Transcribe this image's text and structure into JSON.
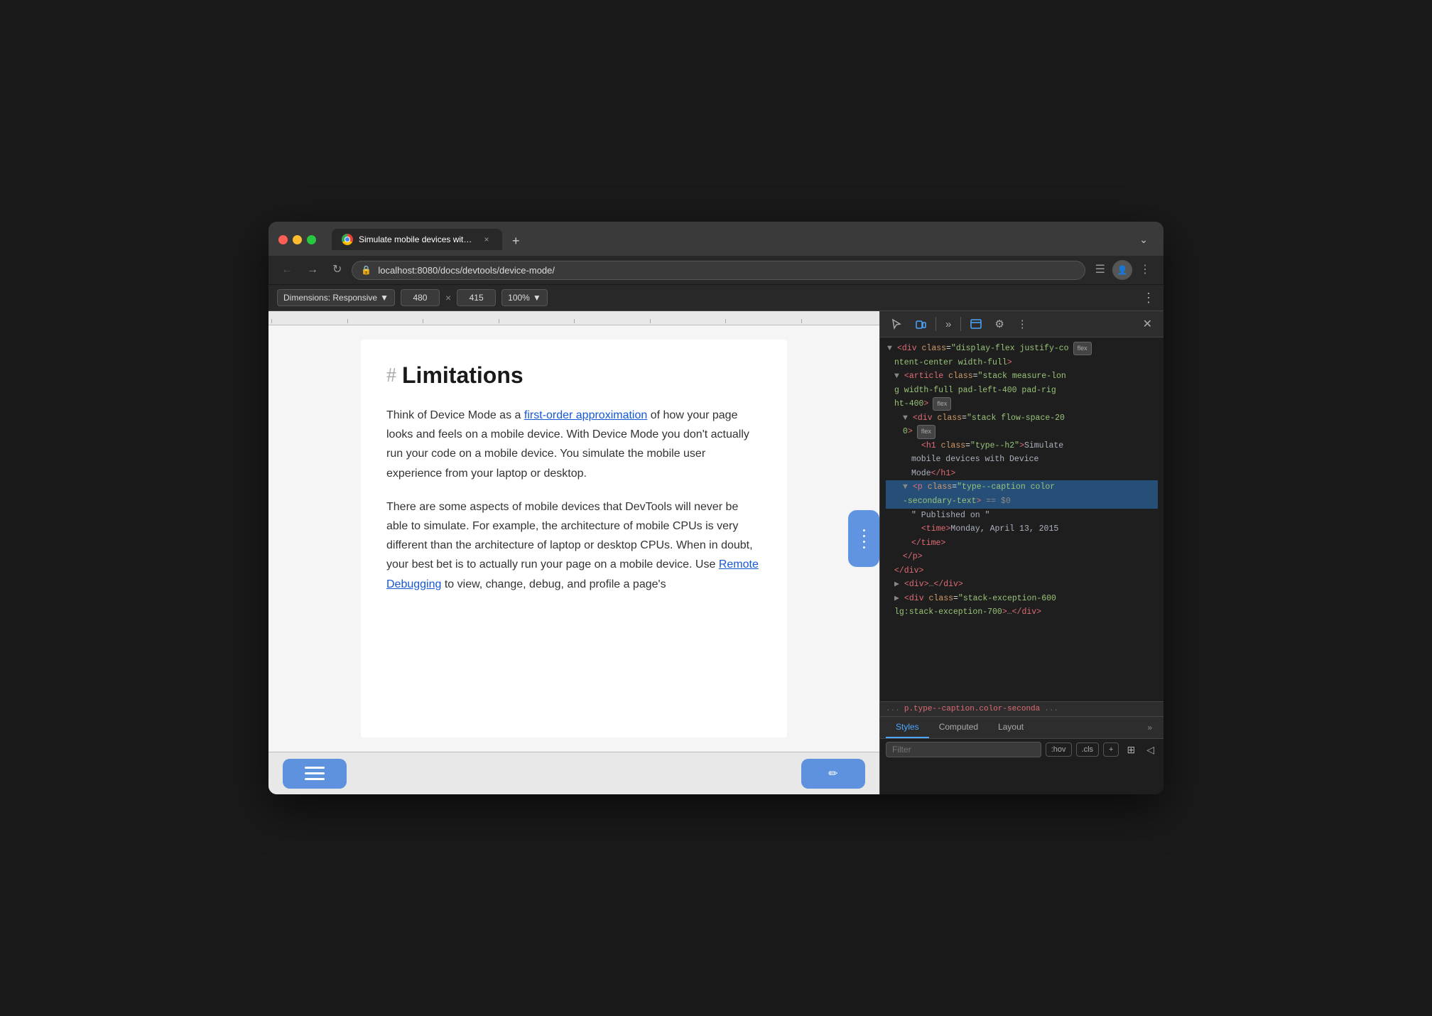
{
  "window": {
    "title": "Chrome Browser"
  },
  "titlebar": {
    "traffic_lights": [
      "close",
      "minimize",
      "maximize"
    ],
    "tab": {
      "title": "Simulate mobile devices with D",
      "close_label": "×"
    },
    "new_tab_label": "+",
    "tab_menu_label": "⌄"
  },
  "navbar": {
    "back_label": "←",
    "forward_label": "→",
    "reload_label": "↻",
    "address": "localhost:8080/docs/devtools/device-mode/",
    "toggle_sidebar_label": "☰",
    "profile_label": "Guest",
    "more_label": "⋮"
  },
  "device_toolbar": {
    "dimensions_label": "Dimensions: Responsive",
    "width_value": "480",
    "height_value": "415",
    "separator": "×",
    "zoom_label": "100%",
    "more_label": "⋮"
  },
  "viewport": {
    "heading_hash": "#",
    "heading": "Limitations",
    "paragraphs": [
      "Think of Device Mode as a first-order approximation of how your page looks and feels on a mobile device. With Device Mode you don't actually run your code on a mobile device. You simulate the mobile user experience from your laptop or desktop.",
      "There are some aspects of mobile devices that DevTools will never be able to simulate. For example, the architecture of mobile CPUs is very different than the architecture of laptop or desktop CPUs. When in doubt, your best bet is to actually run your page on a mobile device. Use Remote Debugging to view, change, debug, and profile a page's"
    ],
    "link1_text": "first-order approximation",
    "link2_text": "Remote Debugging"
  },
  "devtools": {
    "tools": [
      {
        "name": "cursor-tool",
        "icon": "↖",
        "active": false
      },
      {
        "name": "device-tool",
        "icon": "▭",
        "active": true
      },
      {
        "name": "more-panels",
        "icon": "»",
        "active": false
      },
      {
        "name": "console-tool",
        "icon": "◫",
        "active": false
      },
      {
        "name": "settings-tool",
        "icon": "⚙",
        "active": false
      },
      {
        "name": "more-tool",
        "icon": "⋮",
        "active": false
      },
      {
        "name": "close-devtools",
        "icon": "×",
        "active": false
      }
    ],
    "html_lines": [
      {
        "indent": 0,
        "content": "<div class=\"display-flex justify-co",
        "has_flex": true,
        "flex_label": "flex"
      },
      {
        "indent": 0,
        "content": "ntent-center width-full\">",
        "has_flex": false
      },
      {
        "indent": 1,
        "content": "<article class=\"stack measure-lon",
        "expanded": true
      },
      {
        "indent": 1,
        "content": "g width-full pad-left-400 pad-rig",
        "has_flex": false
      },
      {
        "indent": 1,
        "content": "ht-400\">",
        "has_flex": true,
        "flex_label": "flex"
      },
      {
        "indent": 2,
        "content": "<div class=\"stack flow-space-20",
        "expanded": true
      },
      {
        "indent": 2,
        "content": "0\">",
        "has_flex": true,
        "flex_label": "flex"
      },
      {
        "indent": 3,
        "content": "<h1 class=\"type--h2\">Simulate",
        "has_flex": false
      },
      {
        "indent": 3,
        "content": "mobile devices with Device",
        "has_flex": false
      },
      {
        "indent": 3,
        "content": "Mode</h1>",
        "has_flex": false
      },
      {
        "indent": 2,
        "content": "<p class=\"type--caption color",
        "selected": true,
        "expanded": true
      },
      {
        "indent": 2,
        "content": "-secondary-text\"> == $0",
        "selected": true,
        "pseudo": true
      },
      {
        "indent": 3,
        "content": "\" Published on \"",
        "has_flex": false
      },
      {
        "indent": 3,
        "content": "<time>Monday, April 13, 2015",
        "has_flex": false
      },
      {
        "indent": 3,
        "content": "</time>",
        "has_flex": false
      },
      {
        "indent": 2,
        "content": "</p>",
        "has_flex": false
      },
      {
        "indent": 1,
        "content": "</div>",
        "has_flex": false
      },
      {
        "indent": 1,
        "content": "<div>…</div>",
        "has_flex": false
      },
      {
        "indent": 1,
        "content": "<div class=\"stack-exception-600",
        "has_flex": false
      },
      {
        "indent": 1,
        "content": "lg:stack-exception-700\">…</div>",
        "has_flex": false
      }
    ],
    "breadcrumb": {
      "dots": "...",
      "item": "p.type--caption.color-seconda",
      "more": "..."
    },
    "styles_tabs": [
      {
        "label": "Styles",
        "active": true
      },
      {
        "label": "Computed",
        "active": false
      },
      {
        "label": "Layout",
        "active": false
      },
      {
        "label": "»",
        "active": false
      }
    ],
    "filter_placeholder": "Filter",
    "filter_hov": ":hov",
    "filter_cls": ".cls",
    "filter_add": "+",
    "filter_copy_icon": "⊞",
    "filter_back_icon": "◁"
  }
}
